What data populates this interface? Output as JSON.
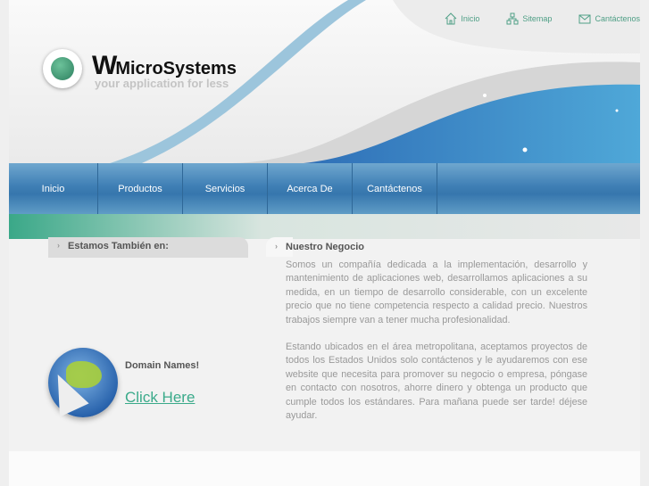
{
  "top_links": [
    {
      "label": "Inicio",
      "icon": "home-icon"
    },
    {
      "label": "Sitemap",
      "icon": "sitemap-icon"
    },
    {
      "label": "Cantáctenos",
      "icon": "mail-icon"
    }
  ],
  "logo": {
    "w": "W",
    "name": "MicroSystems",
    "tagline": "your application for less"
  },
  "nav": [
    "Inicio",
    "Productos",
    "Servicios",
    "Acerca De",
    "Cantáctenos"
  ],
  "sidebar": {
    "heading": "Estamos También en:",
    "domain_title": "Domain Names!",
    "domain_link": "Click Here"
  },
  "main": {
    "heading": "Nuestro Negocio",
    "paragraphs": [
      "Somos un compañía dedicada a la implementación, desarrollo y mantenimiento de aplicaciones web, desarrollamos aplicaciones a su medida, en un tiempo de desarrollo considerable, con un excelente precio que no tiene competencia respecto a calidad precio. Nuestros trabajos siempre van a tener mucha profesionalidad.",
      "Estando ubicados en el área metropolitana, aceptamos proyectos de todos los Estados Unidos solo contáctenos y le ayudaremos con ese website que necesita para promover su negocio o empresa, póngase en contacto con nosotros, ahorre dinero y obtenga un producto que cumple todos los estándares. Para mañana puede ser tarde! déjese ayudar."
    ]
  },
  "colors": {
    "accent": "#3aaa8a",
    "nav": "#3f7fb5"
  }
}
